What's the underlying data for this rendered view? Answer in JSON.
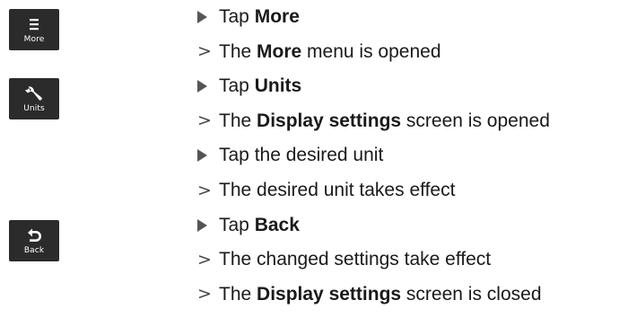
{
  "buttons": {
    "more": {
      "label": "More",
      "icon": "menu-icon"
    },
    "units": {
      "label": "Units",
      "icon": "wrench-icon"
    },
    "back": {
      "label": "Back",
      "icon": "back-arrow-icon"
    }
  },
  "markers": {
    "result": ">"
  },
  "steps": [
    {
      "type": "action",
      "pre": "Tap ",
      "bold": "More",
      "post": ""
    },
    {
      "type": "result",
      "pre": "The ",
      "bold": "More",
      "post": " menu is opened"
    },
    {
      "type": "action",
      "pre": "Tap ",
      "bold": "Units",
      "post": ""
    },
    {
      "type": "result",
      "pre": "The ",
      "bold": "Display settings",
      "post": " screen is opened"
    },
    {
      "type": "action",
      "pre": "Tap the desired unit",
      "bold": "",
      "post": ""
    },
    {
      "type": "result",
      "pre": "The desired unit takes effect",
      "bold": "",
      "post": ""
    },
    {
      "type": "action",
      "pre": "Tap ",
      "bold": "Back",
      "post": ""
    },
    {
      "type": "result",
      "pre": "The changed settings take effect",
      "bold": "",
      "post": ""
    },
    {
      "type": "result",
      "pre": "The ",
      "bold": "Display settings",
      "post": " screen is closed"
    }
  ]
}
